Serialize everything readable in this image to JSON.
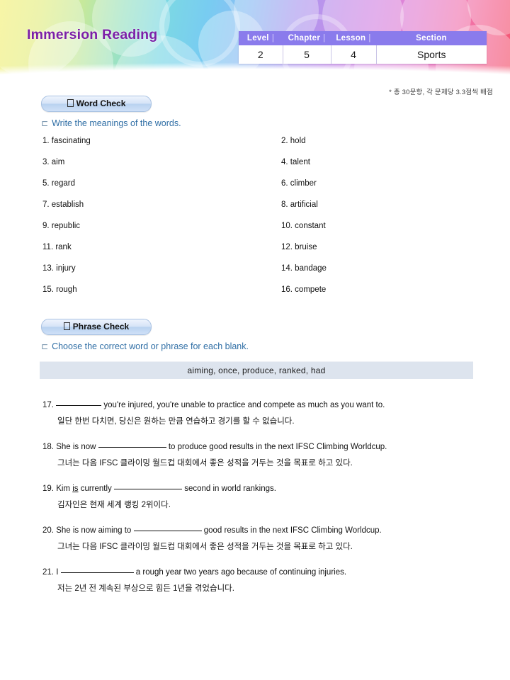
{
  "header": {
    "title": "Immersion Reading",
    "meta_headers": [
      "Level",
      "Chapter",
      "Lesson",
      "Section"
    ],
    "meta_values": [
      "2",
      "5",
      "4",
      "Sports"
    ],
    "score_note": "* 총 30문항, 각 문제당 3.3점씩 배점",
    "title_color": "#7c1fa8",
    "table_header_color": "#8a7bec"
  },
  "word_check": {
    "badge_label": "Word Check",
    "instruction_mark": "⊏",
    "instruction": "Write the meanings of the words.",
    "words": [
      {
        "num": "1.",
        "word": "fascinating"
      },
      {
        "num": "2.",
        "word": "hold"
      },
      {
        "num": "3.",
        "word": "aim"
      },
      {
        "num": "4.",
        "word": "talent"
      },
      {
        "num": "5.",
        "word": "regard"
      },
      {
        "num": "6.",
        "word": "climber"
      },
      {
        "num": "7.",
        "word": "establish"
      },
      {
        "num": "8.",
        "word": "artificial"
      },
      {
        "num": "9.",
        "word": "republic"
      },
      {
        "num": "10.",
        "word": "constant"
      },
      {
        "num": "11.",
        "word": "rank"
      },
      {
        "num": "12.",
        "word": "bruise"
      },
      {
        "num": "13.",
        "word": "injury"
      },
      {
        "num": "14.",
        "word": "bandage"
      },
      {
        "num": "15.",
        "word": "rough"
      },
      {
        "num": "16.",
        "word": "compete"
      }
    ],
    "rows": [
      {
        "left": "1. fascinating",
        "right": "2. hold"
      },
      {
        "left": "3. aim",
        "right": "4. talent"
      },
      {
        "left": "5. regard",
        "right": "6. climber"
      },
      {
        "left": "7. establish",
        "right": "8. artificial"
      },
      {
        "left": "9. republic",
        "right": "10. constant"
      },
      {
        "left": "11. rank",
        "right": "12. bruise"
      },
      {
        "left": "13. injury",
        "right": "14. bandage"
      },
      {
        "left": "15. rough",
        "right": "16. compete"
      }
    ]
  },
  "phrase_check": {
    "badge_label": "Phrase Check",
    "instruction_mark": "⊏",
    "instruction": "Choose the correct word or phrase for each blank.",
    "word_bank": "aiming,  once,  produce,  ranked,  had",
    "word_bank_options": [
      "aiming",
      "once",
      "produce",
      "ranked",
      "had"
    ],
    "questions": [
      {
        "num": "17.",
        "en_before": "",
        "en_after": " you're injured, you're unable to practice and compete as much as you want to.",
        "ko": "일단 한번 다치면, 당신은 원하는 만큼 연습하고 경기를 할 수 없습니다."
      },
      {
        "num": "18.",
        "en_before": "She is now ",
        "en_after": " to produce good results in the next IFSC Climbing Worldcup.",
        "ko": "그녀는 다음 IFSC 클라이밍 월드컵 대회에서 좋은 성적을 거두는 것을 목표로 하고 있다."
      },
      {
        "num": "19.",
        "en_before": "Kim is currently ",
        "en_after": " second in world rankings.",
        "ko": "김자인은 현재 세계 랭킹 2위이다."
      },
      {
        "num": "20.",
        "en_before": "She is now aiming to ",
        "en_after": " good results in the next IFSC Climbing Worldcup.",
        "ko": "그녀는 다음 IFSC 클라이밍 월드컵 대회에서 좋은 성적을 거두는 것을 목표로 하고 있다."
      },
      {
        "num": "21.",
        "en_before": "I ",
        "en_after": " a rough year two years ago because of continuing injuries.",
        "ko": "저는 2년 전 계속된 부상으로 힘든 1년을 겪었습니다."
      }
    ]
  }
}
